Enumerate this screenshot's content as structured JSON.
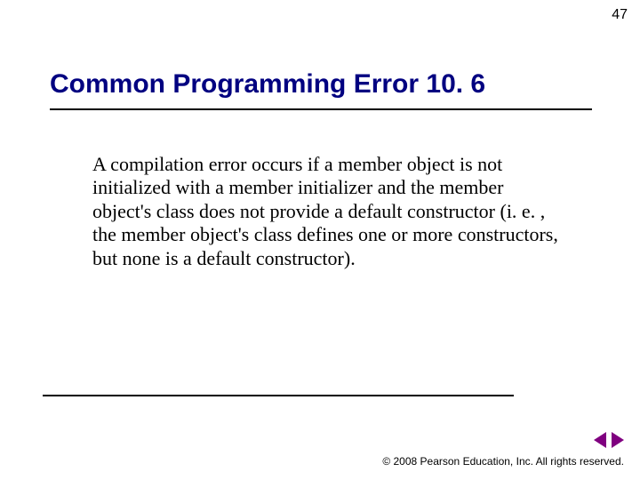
{
  "page_number": "47",
  "title": "Common Programming Error 10. 6",
  "body": "A compilation error occurs if a member object is not initialized with a member initializer and the member object's class does not provide a default constructor (i. e. , the member object's class defines one or more constructors, but none is a default constructor).",
  "copyright": "© 2008 Pearson Education, Inc.  All rights reserved."
}
